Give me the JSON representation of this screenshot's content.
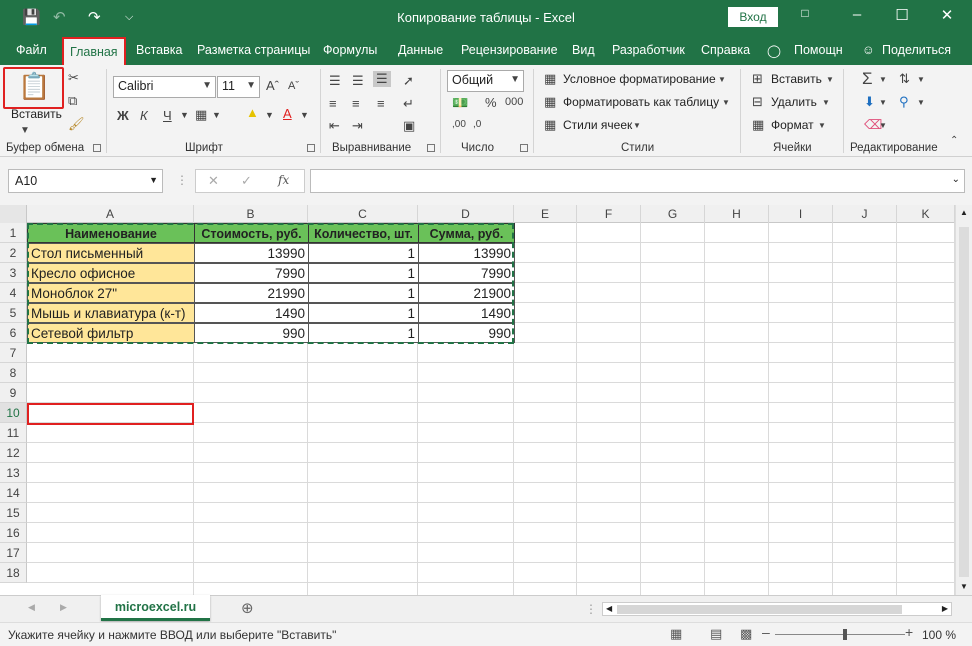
{
  "titlebar": {
    "title": "Копирование таблицы  -  Excel",
    "login": "Вход"
  },
  "menu": {
    "tabs": [
      "Файл",
      "Главная",
      "Вставка",
      "Разметка страницы",
      "Формулы",
      "Данные",
      "Рецензирование",
      "Вид",
      "Разработчик",
      "Справка",
      "Помощн",
      "Поделиться"
    ],
    "active": "Главная"
  },
  "ribbon": {
    "clipboard": {
      "label": "Буфер обмена",
      "paste": "Вставить"
    },
    "font": {
      "label": "Шрифт",
      "name": "Calibri",
      "size": "11"
    },
    "alignment": {
      "label": "Выравнивание"
    },
    "number": {
      "label": "Число",
      "format": "Общий"
    },
    "styles": {
      "label": "Стили",
      "cond": "Условное форматирование",
      "table": "Форматировать как таблицу",
      "cell": "Стили ячеек"
    },
    "cells": {
      "label": "Ячейки",
      "insert": "Вставить",
      "delete": "Удалить",
      "format": "Формат"
    },
    "editing": {
      "label": "Редактирование"
    }
  },
  "formula_bar": {
    "name_box": "A10",
    "fx": "fx",
    "formula": ""
  },
  "grid": {
    "columns": [
      "A",
      "B",
      "C",
      "D",
      "E",
      "F",
      "G",
      "H",
      "I",
      "J",
      "K"
    ],
    "rows": [
      "1",
      "2",
      "3",
      "4",
      "5",
      "6",
      "7",
      "8",
      "9",
      "10",
      "11",
      "12",
      "13",
      "14",
      "15",
      "16",
      "17",
      "18"
    ],
    "headers": [
      "Наименование",
      "Стоимость, руб.",
      "Количество, шт.",
      "Сумма, руб."
    ],
    "data": [
      [
        "Стол письменный",
        "13990",
        "1",
        "13990"
      ],
      [
        "Кресло офисное",
        "7990",
        "1",
        "7990"
      ],
      [
        "Моноблок 27\"",
        "21990",
        "1",
        "21900"
      ],
      [
        "Мышь и клавиатура (к-т)",
        "1490",
        "1",
        "1490"
      ],
      [
        "Сетевой фильтр",
        "990",
        "1",
        "990"
      ]
    ],
    "active_cell": "A10"
  },
  "sheets": {
    "active": "microexcel.ru"
  },
  "status": {
    "text": "Укажите ячейку и нажмите ВВОД или выберите \"Вставить\"",
    "zoom": "100 %"
  },
  "colors": {
    "excel_green": "#217346",
    "header_green": "#6ac159",
    "name_yellow": "#ffe699",
    "highlight_red": "#e02020"
  }
}
